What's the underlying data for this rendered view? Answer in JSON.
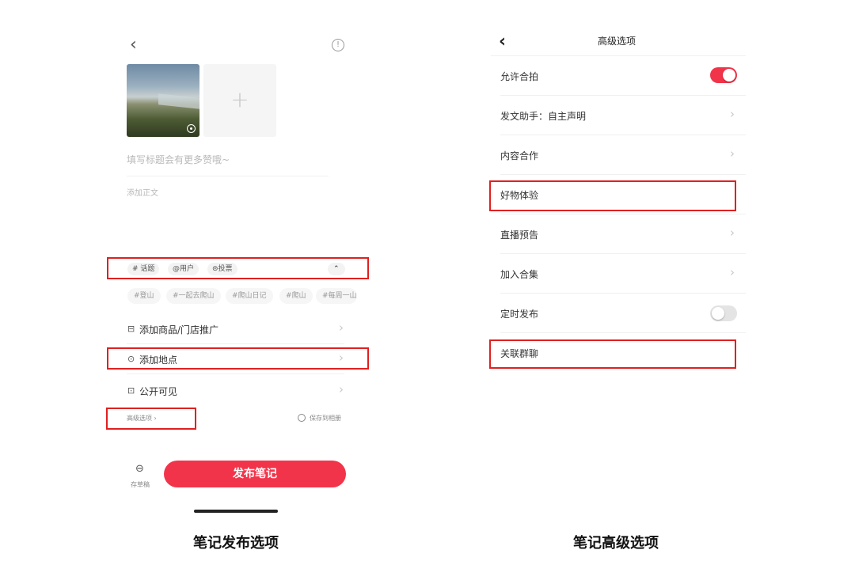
{
  "left_screen": {
    "add_tile_label": "+",
    "title_placeholder": "填写标题会有更多赞哦~",
    "body_placeholder": "添加正文",
    "chips": [
      "# 话题",
      "@用户",
      "投票"
    ],
    "tags": [
      "#登山",
      "#一起去爬山",
      "#爬山日记",
      "#爬山",
      "#每周一山"
    ],
    "rows": {
      "product": "添加商品/门店推广",
      "location": "添加地点",
      "visibility": "公开可见"
    },
    "advanced_link": "高级选项 ›",
    "save_album": "保存到相册",
    "draft_label": "存草稿",
    "publish_label": "发布笔记"
  },
  "right_screen": {
    "title": "高级选项",
    "rows": [
      {
        "label": "允许合拍",
        "control": "toggle",
        "state": "on"
      },
      {
        "label": "发文助手：自主声明",
        "control": "chevron"
      },
      {
        "label": "内容合作",
        "control": "chevron"
      },
      {
        "label": "好物体验",
        "control": "chevron"
      },
      {
        "label": "直播预告",
        "control": "chevron"
      },
      {
        "label": "加入合集",
        "control": "chevron"
      },
      {
        "label": "定时发布",
        "control": "toggle",
        "state": "off"
      },
      {
        "label": "关联群聊",
        "control": "none"
      }
    ]
  },
  "captions": {
    "left": "笔记发布选项",
    "right": "笔记高级选项"
  },
  "colors": {
    "accent": "#f2344a",
    "highlight_box": "#e02020"
  },
  "icons": [
    "back-arrow-icon",
    "info-icon",
    "plus-icon",
    "live-photo-icon",
    "hashtag-icon",
    "at-icon",
    "vote-icon",
    "chevron-up-icon",
    "bag-icon",
    "location-pin-icon",
    "lock-icon",
    "radio-icon",
    "draft-box-icon",
    "chevron-right-icon"
  ]
}
